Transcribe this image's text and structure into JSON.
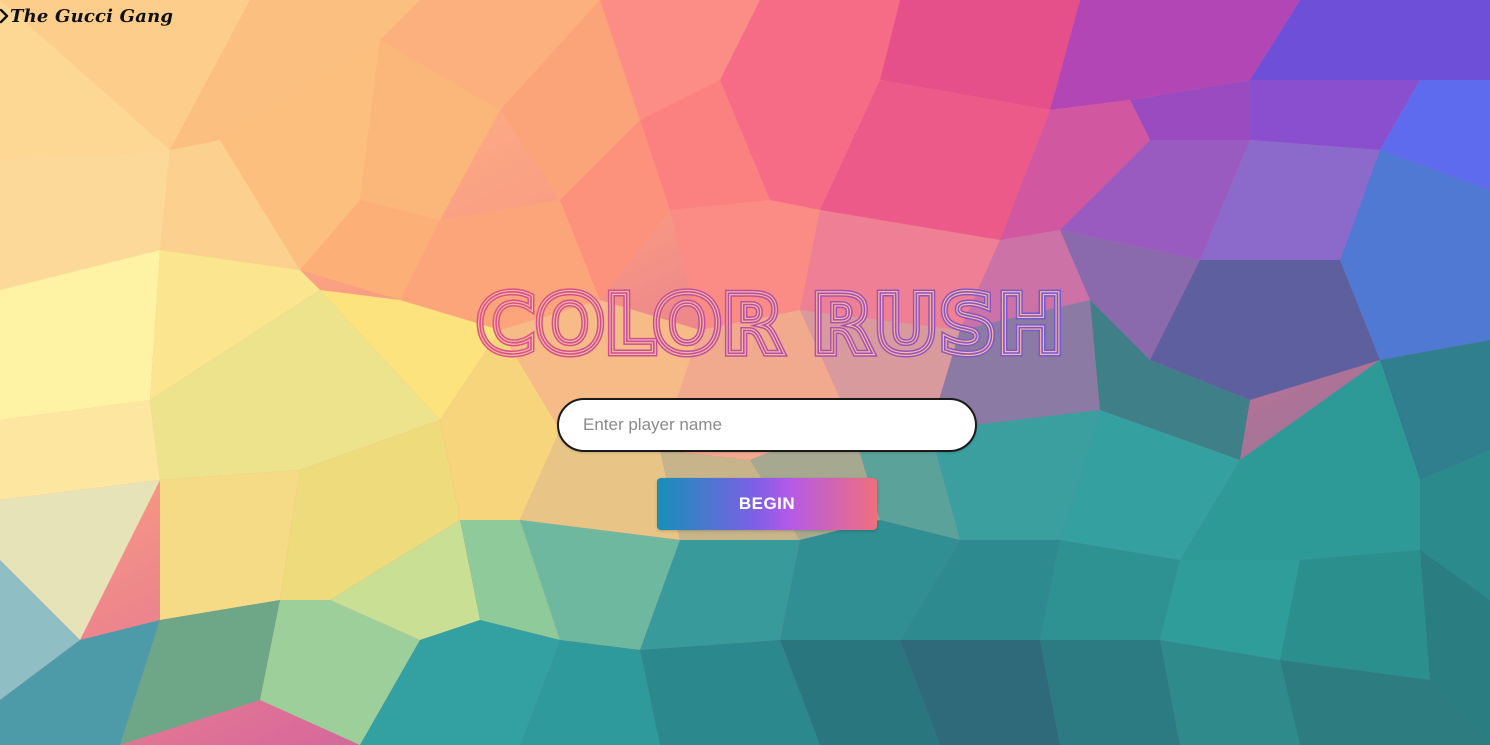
{
  "brand": {
    "icon": "chevron-right-icon",
    "text": "The Gucci Gang"
  },
  "title": {
    "text": "COLOR RUSH"
  },
  "form": {
    "player_name": {
      "value": "",
      "placeholder": "Enter player name"
    },
    "begin_label": "BEGIN"
  },
  "colors": {
    "title_gradient_start": "#e0507f",
    "title_gradient_end": "#6a5ad8",
    "button_gradient": [
      "#1590b8",
      "#7f5fe6",
      "#b35ae8",
      "#ef6f7c"
    ]
  }
}
